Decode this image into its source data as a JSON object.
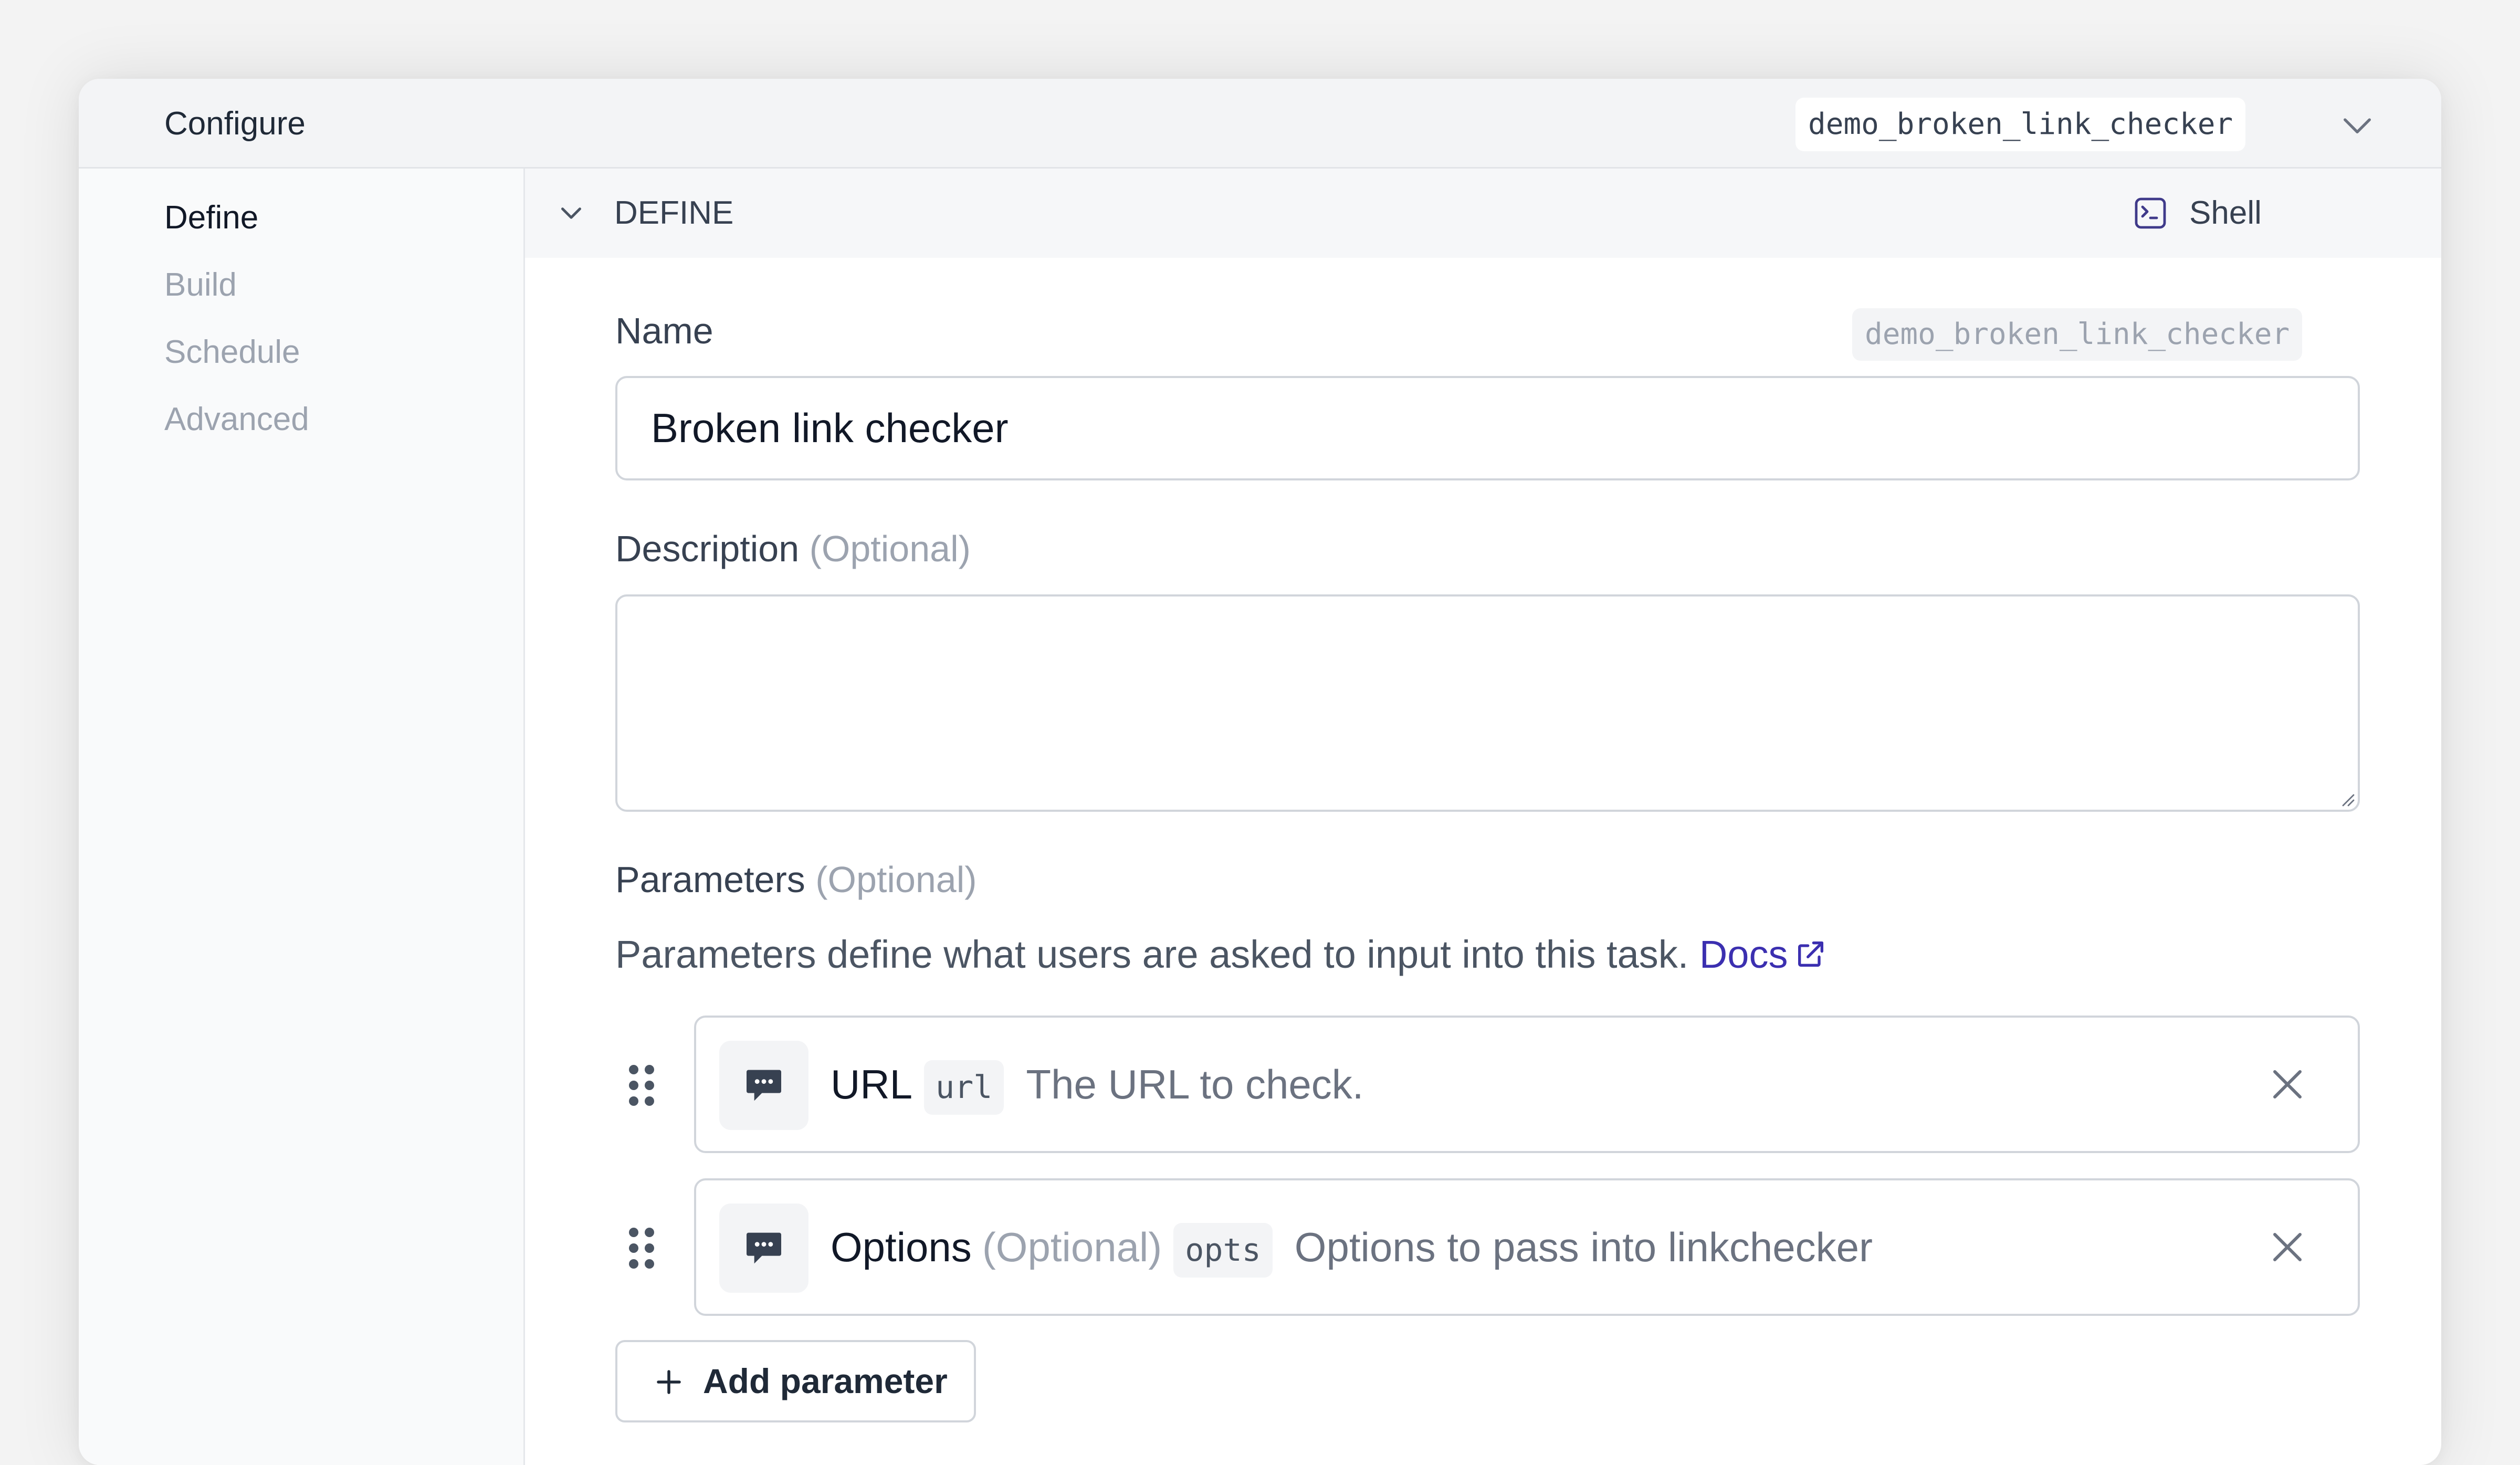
{
  "header": {
    "title": "Configure",
    "slug": "demo_broken_link_checker",
    "dropdown_icon": "chevron-down-icon"
  },
  "sidebar": {
    "items": [
      {
        "label": "Define",
        "active": true
      },
      {
        "label": "Build",
        "active": false
      },
      {
        "label": "Schedule",
        "active": false
      },
      {
        "label": "Advanced",
        "active": false
      }
    ]
  },
  "section": {
    "title": "DEFINE",
    "collapse_icon": "chevron-down-icon",
    "shell_label": "Shell",
    "shell_icon": "terminal-icon"
  },
  "form": {
    "name_label": "Name",
    "name_slug": "demo_broken_link_checker",
    "name_value": "Broken link checker",
    "description_label": "Description",
    "description_optional": "(Optional)",
    "description_value": "",
    "parameters_label": "Parameters",
    "parameters_optional": "(Optional)",
    "parameters_help": "Parameters define what users are asked to input into this task.",
    "docs_link": "Docs"
  },
  "parameters": [
    {
      "name": "URL",
      "optional_text": "",
      "key": "url",
      "description": "The URL to check.",
      "icon": "chat-bubble-icon"
    },
    {
      "name": "Options",
      "optional_text": "(Optional)",
      "key": "opts",
      "description": "Options to pass into linkchecker",
      "icon": "chat-bubble-icon"
    }
  ],
  "add_parameter_label": "Add parameter",
  "colors": {
    "accent_link": "#3b2fb0",
    "icon_dark": "#374151",
    "border": "#d1d5db"
  }
}
